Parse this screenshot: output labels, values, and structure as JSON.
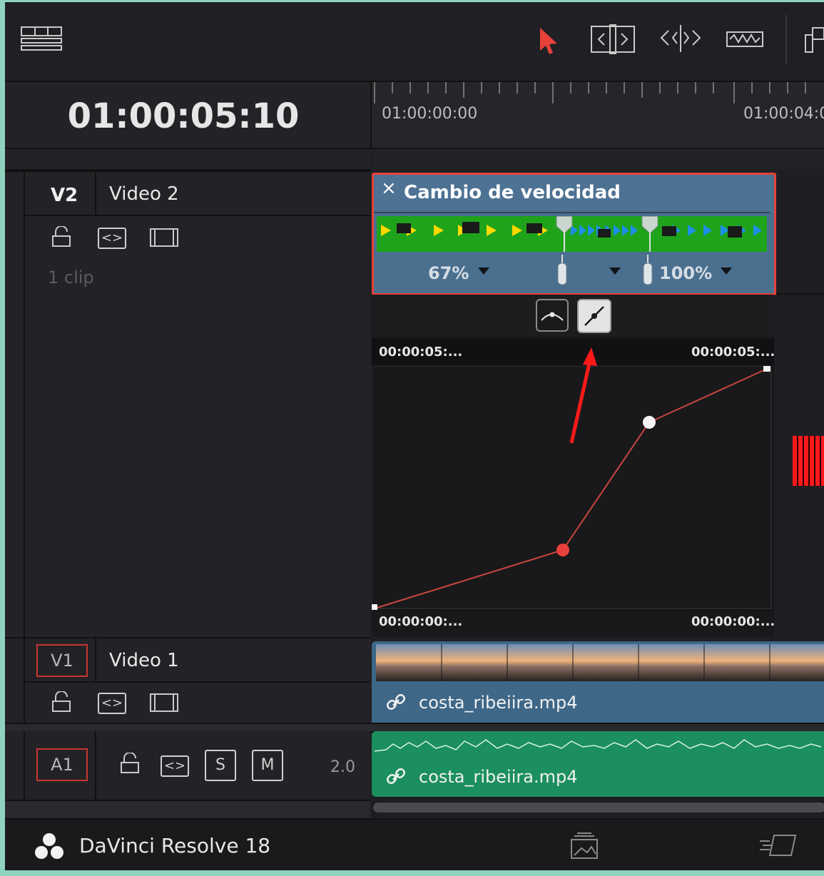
{
  "toolbar": {
    "icons": [
      "timeline-view-icon",
      "selection-pointer-icon",
      "trim-edit-icon",
      "dynamic-trim-icon",
      "blade-icon",
      "insert-icon"
    ]
  },
  "timecode": "01:00:05:10",
  "ruler": {
    "ticks": [
      "01:00:00:00",
      "01:00:04:0"
    ]
  },
  "tracks": {
    "v2": {
      "id": "V2",
      "name": "Video 2",
      "clips": "1 clip"
    },
    "v1": {
      "id": "V1",
      "name": "Video 1"
    },
    "a1": {
      "id": "A1",
      "solo": "S",
      "mute": "M",
      "channels": "2.0"
    }
  },
  "speed_clip": {
    "title": "Cambio de velocidad",
    "close": "×",
    "speed_left": "67%",
    "speed_right": "100%"
  },
  "graph": {
    "top_left": "00:00:05:...",
    "top_right": "00:00:05:...",
    "bottom_left": "00:00:00:...",
    "bottom_right": "00:00:00:...",
    "line_color": "#c8463f"
  },
  "v1_clip": {
    "name": "costa_ribeiira.mp4"
  },
  "a1_clip": {
    "name": "costa_ribeiira.mp4"
  },
  "footer": {
    "app_name": "DaVinci Resolve 18"
  }
}
